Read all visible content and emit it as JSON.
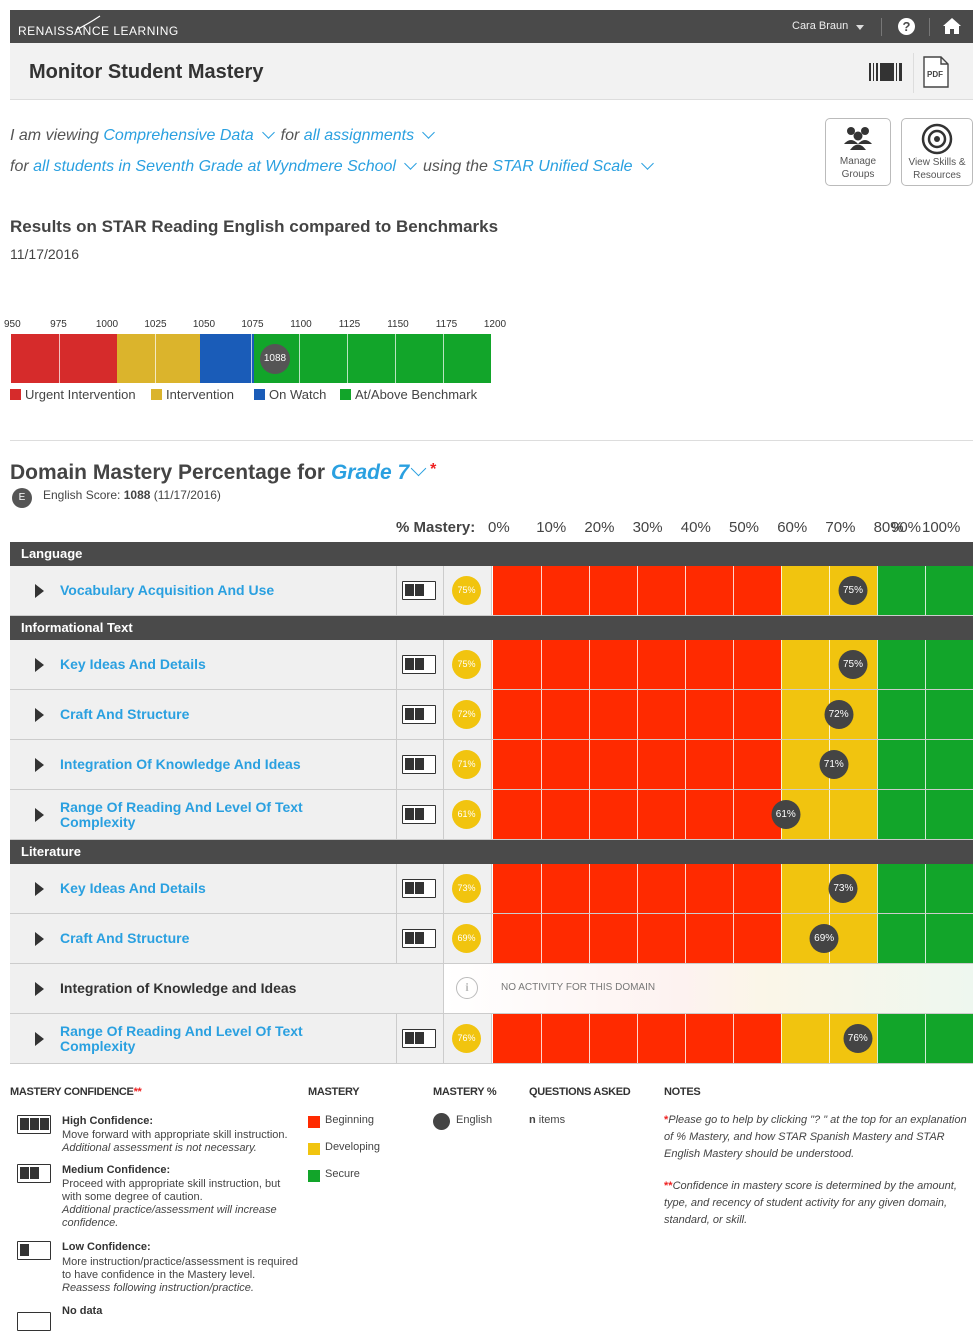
{
  "app": {
    "brand": "RENAISSANCE LEARNING",
    "user_name": "Cara Braun",
    "page_title": "Monitor Student Mastery"
  },
  "filters": {
    "line1_prefix": "I am viewing",
    "data_type": "Comprehensive Data",
    "line1_mid": "for",
    "assignments": "all assignments",
    "line2_prefix": "for",
    "students": "all students in Seventh Grade at Wyndmere School",
    "line2_mid": "using the",
    "scale": "STAR Unified Scale"
  },
  "actions": {
    "manage_groups": "Manage Groups",
    "view_skills": "View Skills & Resources",
    "pdf": "PDF"
  },
  "results": {
    "title": "Results on STAR Reading English compared to Benchmarks",
    "date": "11/17/2016",
    "score": "1088",
    "ticks": [
      "950",
      "975",
      "1000",
      "1025",
      "1050",
      "1075",
      "1100",
      "1125",
      "1150",
      "1175",
      "1200"
    ],
    "legend": [
      "Urgent Intervention",
      "Intervention",
      "On Watch",
      "At/Above Benchmark"
    ],
    "colors": {
      "urgent": "#d62b2b",
      "intervention": "#dbb42c",
      "watch": "#1a5cb8",
      "benchmark": "#12a52a"
    }
  },
  "domain": {
    "title_prefix": "Domain Mastery Percentage for",
    "grade": "Grade 7",
    "star": "*",
    "badge": "E",
    "score_label": "English Score:",
    "score_value": "1088",
    "score_date": "(11/17/2016)",
    "mastery_label": "% Mastery:",
    "mastery_ticks": [
      "0%",
      "10%",
      "20%",
      "30%",
      "40%",
      "50%",
      "60%",
      "70%",
      "80%",
      "90%",
      "100%"
    ]
  },
  "sections": [
    {
      "name": "Language",
      "rows": [
        {
          "name": "Vocabulary Acquisition And Use",
          "pct": "75%",
          "confidence": "medium",
          "active": true
        }
      ]
    },
    {
      "name": "Informational Text",
      "rows": [
        {
          "name": "Key Ideas And Details",
          "pct": "75%",
          "confidence": "medium",
          "active": true
        },
        {
          "name": "Craft And Structure",
          "pct": "72%",
          "confidence": "medium",
          "active": true
        },
        {
          "name": "Integration Of Knowledge And Ideas",
          "pct": "71%",
          "confidence": "medium",
          "active": true
        },
        {
          "name": "Range Of Reading And Level Of Text Complexity",
          "pct": "61%",
          "confidence": "medium",
          "active": true
        }
      ]
    },
    {
      "name": "Literature",
      "rows": [
        {
          "name": "Key Ideas And Details",
          "pct": "73%",
          "confidence": "medium",
          "active": true
        },
        {
          "name": "Craft And Structure",
          "pct": "69%",
          "confidence": "medium",
          "active": true
        },
        {
          "name": "Integration of Knowledge and Ideas",
          "pct": "",
          "confidence": "none",
          "active": false,
          "message": "NO ACTIVITY FOR THIS DOMAIN"
        },
        {
          "name": "Range Of Reading And Level Of Text Complexity",
          "pct": "76%",
          "confidence": "medium",
          "active": true
        }
      ]
    }
  ],
  "legend": {
    "confidence_header": "MASTERY CONFIDENCE",
    "confidence_star": "**",
    "high_title": "High Confidence:",
    "high_text": "Move forward with appropriate skill instruction.",
    "high_italic": "Additional assessment is not necessary.",
    "medium_title": "Medium Confidence:",
    "medium_text": "Proceed with appropriate skill instruction, but with some degree of caution.",
    "medium_italic": "Additional practice/assessment will increase confidence.",
    "low_title": "Low Confidence:",
    "low_text": "More instruction/practice/assessment is required to have confidence in the Mastery level.",
    "low_italic": "Reassess following instruction/practice.",
    "nodata_title": "No data",
    "mastery_header": "MASTERY",
    "mastery_items": [
      "Beginning",
      "Developing",
      "Secure"
    ],
    "mastery_colors": [
      "#ff2a00",
      "#f1c40f",
      "#12a52a"
    ],
    "pct_header": "MASTERY %",
    "pct_item": "English",
    "questions_header": "QUESTIONS ASKED",
    "questions_n": "n",
    "questions_text": "items",
    "notes_header": "NOTES",
    "note1_star": "*",
    "note1": "Please go to help by clicking \"? \" at the top for an explanation of % Mastery, and how STAR Spanish Mastery and STAR English Mastery should be understood.",
    "note2_star": "**",
    "note2": "Confidence in mastery score is determined by the amount, type, and recency of student activity for any given domain, standard, or skill."
  }
}
